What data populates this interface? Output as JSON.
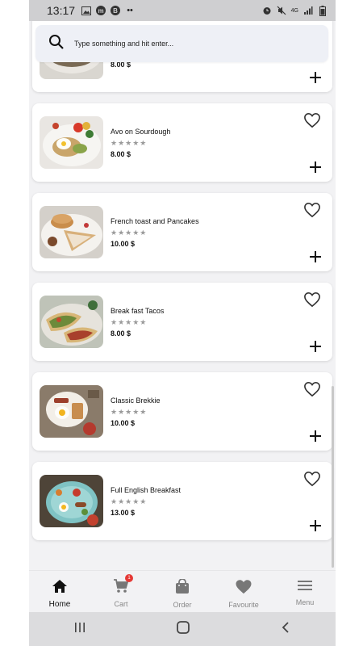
{
  "status_bar": {
    "time": "13:17",
    "right_indicators": "4G"
  },
  "search": {
    "placeholder": "Type something and hit enter..."
  },
  "items": [
    {
      "name": "",
      "rating": "★★★★★",
      "price": "8.00 $"
    },
    {
      "name": "Avo on Sourdough",
      "rating": "★★★★★",
      "price": "8.00 $"
    },
    {
      "name": "French toast and Pancakes",
      "rating": "★★★★★",
      "price": "10.00 $"
    },
    {
      "name": "Break fast Tacos",
      "rating": "★★★★★",
      "price": "8.00 $"
    },
    {
      "name": "Classic Brekkie",
      "rating": "★★★★★",
      "price": "10.00 $"
    },
    {
      "name": "Full English Breakfast",
      "rating": "★★★★★",
      "price": "13.00 $"
    }
  ],
  "bottom_nav": {
    "home": "Home",
    "cart": "Cart",
    "cart_badge": "1",
    "order": "Order",
    "favourite": "Favourite",
    "menu": "Menu"
  },
  "colors": {
    "badge": "#e53935",
    "card": "#ffffff",
    "background": "#f2f2f4"
  }
}
